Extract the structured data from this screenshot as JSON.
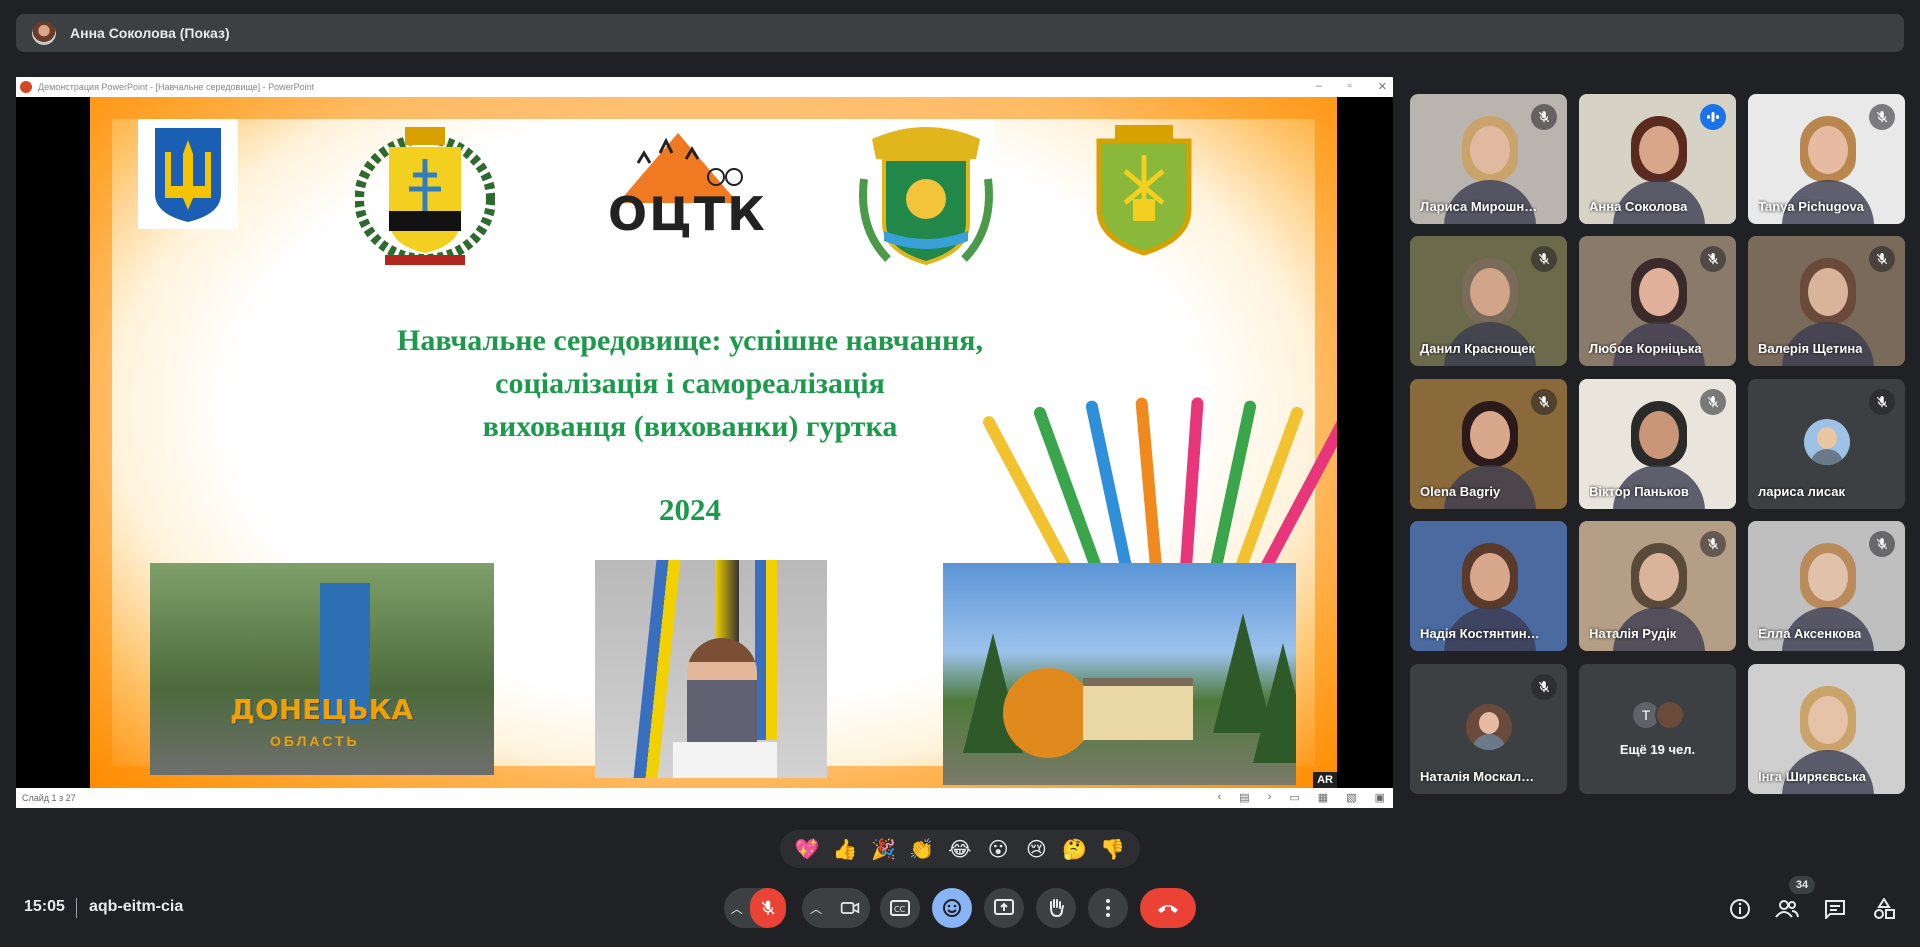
{
  "presenter_bar": {
    "label": "Анна Соколова (Показ)"
  },
  "ppt": {
    "window_title": "Демонстрация PowerPoint - [Навчальне середовище] - PowerPoint",
    "status": "Слайд 1 з 27"
  },
  "slide": {
    "logo_text": "ОЦТК",
    "title_lines": [
      "Навчальне середовище: успішне навчання,",
      "соціалізація і самореалізація",
      "вихованця (вихованки) гуртка"
    ],
    "year": "2024",
    "sign_text": "ДОНЕЦЬКА",
    "sign_sub": "ОБЛАСТЬ",
    "corner_mark": "AR"
  },
  "participants": [
    {
      "name": "Лариса Мирошн…",
      "muted": true,
      "bg": "#b9b4ae",
      "skin": "#e0b9a0",
      "hair": "#c9a36a"
    },
    {
      "name": "Анна Соколова",
      "muted": false,
      "speaking": true,
      "bg": "#d7d2c6",
      "skin": "#d9a58b",
      "hair": "#5a2a1f"
    },
    {
      "name": "Tanya Pichugova",
      "muted": true,
      "bg": "#e9e9e9",
      "skin": "#e6bba2",
      "hair": "#b9874e"
    },
    {
      "name": "Данил Краснощек",
      "muted": true,
      "bg": "#6b6a4a",
      "skin": "#d1a58a",
      "hair": "#7a6a5a"
    },
    {
      "name": "Любов Корніцька",
      "muted": true,
      "bg": "#8a7a6a",
      "skin": "#e0b09a",
      "hair": "#3a2a2a"
    },
    {
      "name": "Валерія Щетина",
      "muted": true,
      "bg": "#7a6a5a",
      "skin": "#d9b49a",
      "hair": "#6a4a3a"
    },
    {
      "name": "Olena Bagriy",
      "muted": true,
      "bg": "#8a6a3a",
      "skin": "#d9a88c",
      "hair": "#2a1a1a"
    },
    {
      "name": "Віктор Паньков",
      "muted": true,
      "bg": "#e9e4dc",
      "skin": "#c99678",
      "hair": "#2a2a2a"
    },
    {
      "name": "лариса лисак",
      "muted": true,
      "avatar": true,
      "bg": "#3c4043",
      "skin": "#e8c7a2",
      "hair": "#9ec1e6"
    },
    {
      "name": "Надія Костянтин…",
      "muted": false,
      "bg": "#4a6aa0",
      "skin": "#d9a88c",
      "hair": "#5a3a2a"
    },
    {
      "name": "Наталія Рудік",
      "muted": true,
      "bg": "#b49e86",
      "skin": "#d9b49a",
      "hair": "#5a4a3a"
    },
    {
      "name": "Елла Аксенкова",
      "muted": true,
      "bg": "#bfbfbf",
      "skin": "#e0c2aa",
      "hair": "#b98a5a"
    },
    {
      "name": "Наталія Москал…",
      "muted": true,
      "avatar": true,
      "bg": "#3c4043",
      "skin": "#e6bba2",
      "hair": "#6a4a3a"
    },
    {
      "name": "",
      "more": true,
      "more_label": "Ещё 19 чел.",
      "initial": "T"
    },
    {
      "name": "Інга Ширяєвська",
      "muted": false,
      "bg": "#cfcfcf",
      "skin": "#e6c3a8",
      "hair": "#c9a36a"
    }
  ],
  "reactions": [
    "💖",
    "👍",
    "🎉",
    "👏",
    "😂",
    "😮",
    "😢",
    "🤔",
    "👎"
  ],
  "meeting": {
    "time": "15:05",
    "code": "aqb-eitm-cia"
  },
  "people_count": "34",
  "colors": {
    "accent": "#8ab4f8",
    "danger": "#ea4335",
    "bg": "#202124",
    "surface": "#3c4043"
  }
}
